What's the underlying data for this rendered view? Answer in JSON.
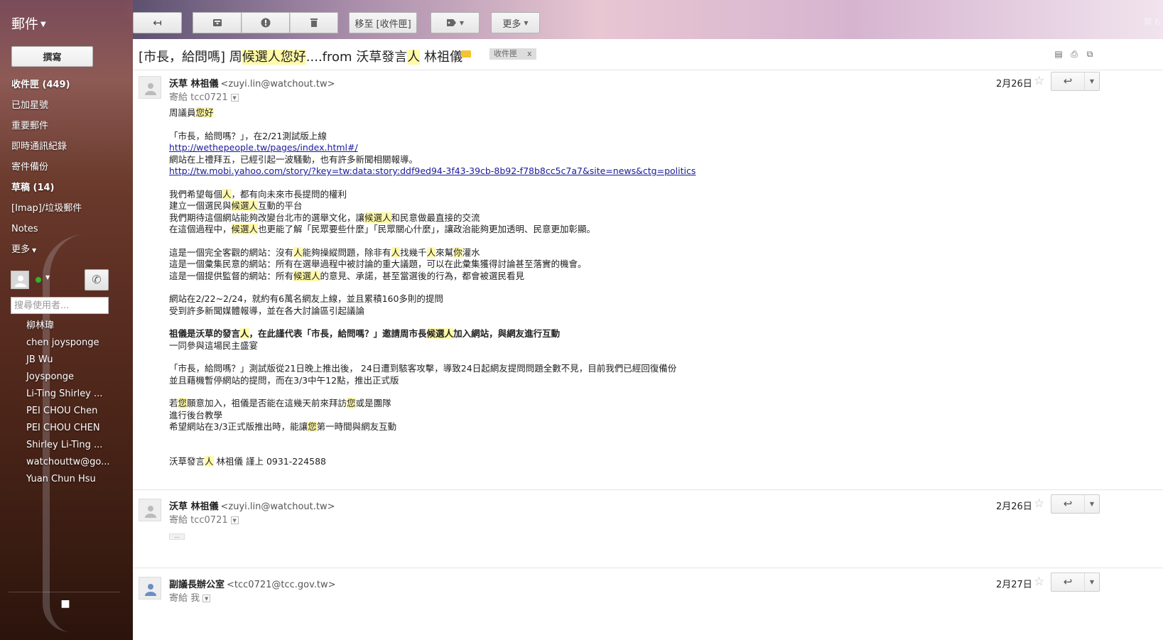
{
  "app": {
    "title": "郵件",
    "page_indicator": "第 6"
  },
  "toolbar": {
    "back_icon": "back-arrow-icon",
    "archive_icon": "archive-icon",
    "spam_icon": "report-spam-icon",
    "delete_icon": "trash-icon",
    "move_to_label": "移至 [收件匣]",
    "labels_icon": "label-tag-icon",
    "more_label": "更多"
  },
  "sidebar": {
    "compose_label": "撰寫",
    "items": [
      {
        "label": "收件匣 (449)",
        "bold": true
      },
      {
        "label": "已加星號",
        "bold": false
      },
      {
        "label": "重要郵件",
        "bold": false
      },
      {
        "label": "即時通訊紀錄",
        "bold": false
      },
      {
        "label": "寄件備份",
        "bold": false
      },
      {
        "label": "草稿 (14)",
        "bold": true
      },
      {
        "label": "[Imap]/垃圾郵件",
        "bold": false
      },
      {
        "label": "Notes",
        "bold": false
      },
      {
        "label": "更多",
        "bold": false
      }
    ],
    "chat_search_placeholder": "搜尋使用者...",
    "contacts": [
      "柳林瑋",
      "chen joysponge",
      "JB Wu",
      "Joysponge",
      "Li-Ting Shirley ...",
      "PEI CHOU Chen",
      "PEI CHOU CHEN",
      "Shirley Li-Ting ...",
      "watchouttw@go...",
      "Yuan Chun Hsu"
    ]
  },
  "thread": {
    "subject_parts": [
      {
        "text": "[市長，給問嗎] 周",
        "hl": false
      },
      {
        "text": "候選人",
        "hl": true
      },
      {
        "text": "您好",
        "hl": true
      },
      {
        "text": "....from 沃草發言",
        "hl": false
      },
      {
        "text": "人",
        "hl": true
      },
      {
        "text": " 林祖儀",
        "hl": false
      }
    ],
    "label": "收件匣",
    "label_close": "x",
    "messages": [
      {
        "sender_name": "沃草 林祖儀",
        "sender_email": "<zuyi.lin@watchout.tw>",
        "to": "寄給 tcc0721",
        "date": "2月26日"
      },
      {
        "sender_name": "沃草 林祖儀",
        "sender_email": "<zuyi.lin@watchout.tw>",
        "to": "寄給 tcc0721",
        "date": "2月26日",
        "collapsed": "..."
      },
      {
        "sender_name": "副議長辦公室",
        "sender_email": "<tcc0721@tcc.gov.tw>",
        "to": "寄給 我",
        "date": "2月27日"
      }
    ],
    "body": {
      "greeting_a": "周議員",
      "greeting_b": "您好",
      "p1_l1": "「市長，給問嗎？」，在2/21測試版上線",
      "p1_link1": "http://wethepeople.tw/pages/index.html#/",
      "p1_l3": "網站在上禮拜五，已經引起一波騷動，也有許多新聞相關報導。",
      "p1_link2": "http://tw.mobi.yahoo.com/story/?key=tw:data:story:ddf9ed94-3f43-39cb-8b92-f78b8cc5c7a7&site=news&ctg=politics",
      "p2_l1_a": "我們希望每個",
      "p2_l1_b": "人",
      "p2_l1_c": "，都有向未來市長提問的權利",
      "p2_l2_a": "建立一個選民與",
      "p2_l2_b": "候選人",
      "p2_l2_c": "互動的平台",
      "p2_l3_a": "我們期待這個網站能夠改變台北市的選舉文化，讓",
      "p2_l3_b": "候選人",
      "p2_l3_c": "和民意做最直接的交流",
      "p2_l4_a": "在這個過程中，",
      "p2_l4_b": "候選人",
      "p2_l4_c": "也更能了解「民眾要些什麼」「民眾關心什麼」，讓政治能夠更加透明、民意更加彰顯。",
      "p3_l1_a": "這是一個完全客觀的網站：沒有",
      "p3_l1_b": "人",
      "p3_l1_c": "能夠操縱問題，除非有",
      "p3_l1_d": "人",
      "p3_l1_e": "找幾千",
      "p3_l1_f": "人",
      "p3_l1_g": "來幫",
      "p3_l1_h": "你",
      "p3_l1_i": "灌水",
      "p3_l2": "這是一個彙集民意的網站：所有在選舉過程中被討論的重大議題，可以在此彙集獲得討論甚至落實的機會。",
      "p3_l3_a": "這是一個提供監督的網站：所有",
      "p3_l3_b": "候選人",
      "p3_l3_c": "的意見、承諾，甚至當選後的行為，都會被選民看見",
      "p4_l1": "網站在2/22~2/24，就約有6萬名網友上線，並且累積160多則的提問",
      "p4_l2": "受到許多新聞媒體報導，並在各大討論區引起議論",
      "p5_l1_a": "祖儀是沃草的發言",
      "p5_l1_b": "人",
      "p5_l1_c": "，在此謹代表「市長，給問嗎？」邀請周市長",
      "p5_l1_d": "候選人",
      "p5_l1_e": "加入網站，與網友進行互動",
      "p5_l2": "一同參與這場民主盛宴",
      "p6_l1": "「市長，給問嗎？」測試版從21日晚上推出後， 24日遭到駭客攻擊，導致24日起網友提問問題全數不見，目前我們已經回復備份",
      "p6_l2": "並且藉機暫停網站的提問，而在3/3中午12點，推出正式版",
      "p7_l1_a": "若",
      "p7_l1_b": "您",
      "p7_l1_c": "願意加入，祖儀是否能在這幾天前來拜訪",
      "p7_l1_d": "您",
      "p7_l1_e": "或是團隊",
      "p7_l2": "進行後台教學",
      "p7_l3_a": "希望網站在3/3正式版推出時，能讓",
      "p7_l3_b": "您",
      "p7_l3_c": "第一時間與網友互動",
      "sig_a": "沃草發言",
      "sig_b": "人",
      "sig_c": " 林祖儀 謹上 0931-224588"
    }
  }
}
